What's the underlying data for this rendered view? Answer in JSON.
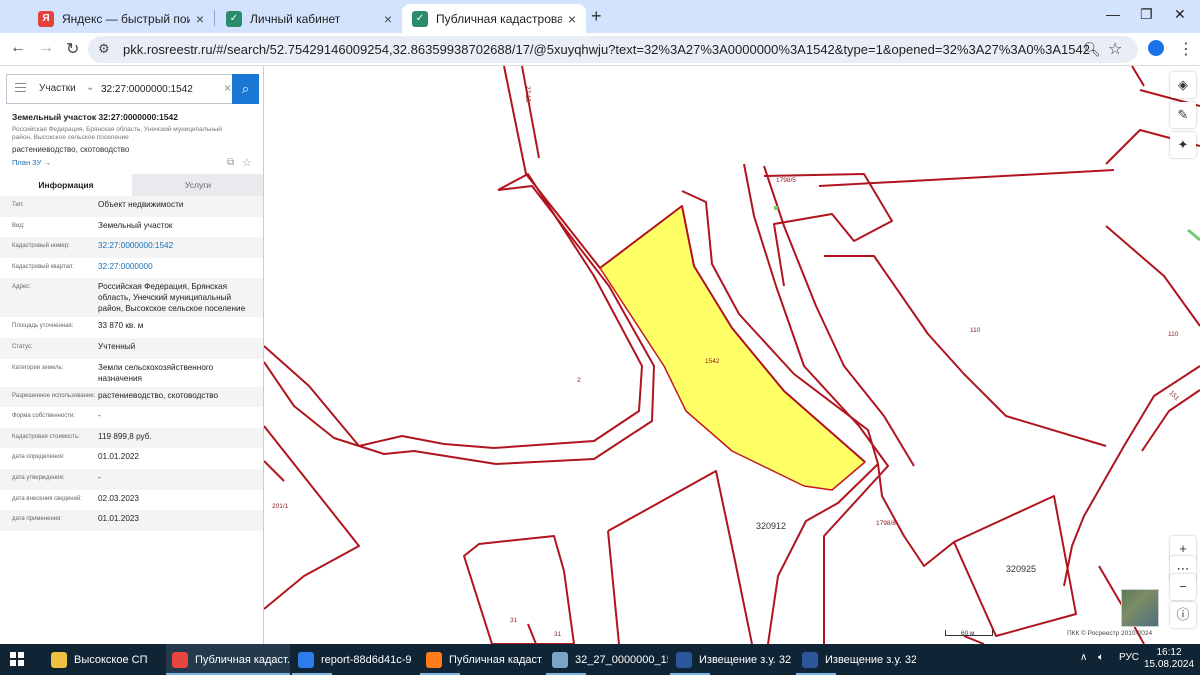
{
  "browser": {
    "tabs": [
      {
        "title": "Яндекс — быстрый поиск в ин",
        "icon": "yandex-icon",
        "color": "#e3413c"
      },
      {
        "title": "Личный кабинет",
        "icon": "rosreestr-icon",
        "color": "#2a8c6a"
      },
      {
        "title": "Публичная кадастровая карта",
        "icon": "rosreestr-icon",
        "color": "#2a8c6a"
      }
    ],
    "url": "pkk.rosreestr.ru/#/search/52.75429146009254,32.86359938702688/17/@5xuyqhwju?text=32%3A27%3A0000000%3A1542&type=1&opened=32%3A27%3A0%3A1542"
  },
  "panel": {
    "search_type": "Участки",
    "search_value": "32:27:0000000:1542",
    "object_title": "Земельный участок 32:27:0000000:1542",
    "object_address": "Российская Федерация, Брянская область, Унечский муниципальный район, Высокское сельское поселение",
    "object_use": "растениеводство, скотоводство",
    "plan_link": "План ЗУ →",
    "tabs": [
      "Информация",
      "Услуги"
    ],
    "rows": [
      {
        "k": "Тип:",
        "v": "Объект недвижимости"
      },
      {
        "k": "Вид:",
        "v": "Земельный участок"
      },
      {
        "k": "Кадастровый номер:",
        "v": "32:27:0000000:1542",
        "link": true
      },
      {
        "k": "Кадастровый квартал:",
        "v": "32:27:0000000",
        "link": true
      },
      {
        "k": "Адрес:",
        "v": "Российская Федерация, Брянская область, Унечский муниципальный район, Высокское сельское поселение"
      },
      {
        "k": "Площадь уточненная:",
        "v": "33 870 кв. м"
      },
      {
        "k": "Статус:",
        "v": "Учтенный"
      },
      {
        "k": "Категория земель:",
        "v": "Земли сельскохозяйственного назначения"
      },
      {
        "k": "Разрешенное использование:",
        "v": "растениеводство, скотоводство"
      },
      {
        "k": "Форма собственности:",
        "v": "-"
      },
      {
        "k": "Кадастровая стоимость:",
        "v": "119 899,8 руб."
      },
      {
        "k": "дата определения:",
        "v": "01.01.2022"
      },
      {
        "k": "дата утверждения:",
        "v": "-"
      },
      {
        "k": "дата внесения сведений:",
        "v": "02.03.2023"
      },
      {
        "k": "дата применения:",
        "v": "01.01.2023"
      }
    ]
  },
  "map": {
    "labels": [
      {
        "text": "27:15",
        "cls": "small"
      },
      {
        "text": "1798/5",
        "cls": "small"
      },
      {
        "text": "110",
        "cls": "small"
      },
      {
        "text": "110",
        "cls": "small"
      },
      {
        "text": "2",
        "cls": "small"
      },
      {
        "text": "1542",
        "cls": "small"
      },
      {
        "text": "151",
        "cls": "small"
      },
      {
        "text": "201/1",
        "cls": "small"
      },
      {
        "text": "320912",
        "cls": "big"
      },
      {
        "text": "1798/8",
        "cls": "small"
      },
      {
        "text": "320925",
        "cls": "big"
      },
      {
        "text": "31",
        "cls": "small"
      },
      {
        "text": "31",
        "cls": "small"
      }
    ],
    "scale": "60 м",
    "copyright": "ПКК © Росреестр 2010-2024",
    "highlight_color": "#ffff66",
    "boundary_color": "#b0151e"
  },
  "taskbar": {
    "items": [
      {
        "label": "Высокское СП",
        "color": "#f0c040"
      },
      {
        "label": "Публичная кадаст...",
        "color": "#e8453c"
      },
      {
        "label": "report-88d6d41c-9...",
        "color": "#2b7de9"
      },
      {
        "label": "Публичная кадаст...",
        "color": "#ff7a1a"
      },
      {
        "label": "32_27_0000000_15...",
        "color": "#7aa6c8"
      },
      {
        "label": "Извещение з.у. 32 ...",
        "color": "#2b579a"
      },
      {
        "label": "Извещение з.у. 32 ...",
        "color": "#2b579a"
      }
    ],
    "lang": "РУС",
    "time": "16:12",
    "date": "15.08.2024"
  }
}
